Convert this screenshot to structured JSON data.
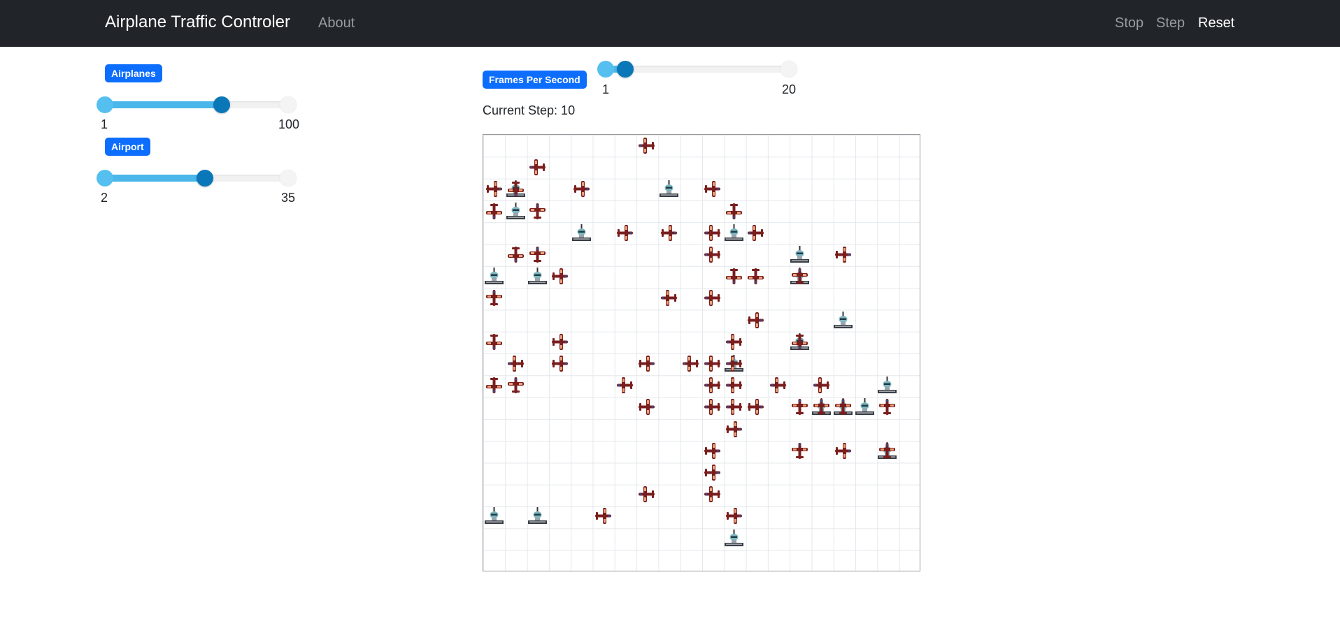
{
  "navbar": {
    "brand": "Airplane Traffic Controler",
    "about": "About",
    "stop": "Stop",
    "step": "Step",
    "reset": "Reset"
  },
  "airplanes_control": {
    "label": "Airplanes",
    "min_label": "1",
    "max_label": "100",
    "min": 1,
    "max": 100,
    "value": 64
  },
  "airport_control": {
    "label": "Airport",
    "min_label": "2",
    "max_label": "35",
    "min": 2,
    "max": 35,
    "value": 20
  },
  "fps_control": {
    "label": "Frames Per Second",
    "min_label": "1",
    "max_label": "20",
    "min": 1,
    "max": 20,
    "value": 3
  },
  "status": {
    "current_step": "Current Step: 10"
  },
  "grid": {
    "rows": 20,
    "cols": 20,
    "airports": [
      [
        2,
        1
      ],
      [
        2,
        8
      ],
      [
        3,
        1
      ],
      [
        4,
        4
      ],
      [
        4,
        11
      ],
      [
        5,
        14
      ],
      [
        6,
        0
      ],
      [
        6,
        2
      ],
      [
        6,
        14
      ],
      [
        8,
        16
      ],
      [
        9,
        14
      ],
      [
        10,
        11
      ],
      [
        11,
        18
      ],
      [
        12,
        15
      ],
      [
        12,
        16
      ],
      [
        12,
        17
      ],
      [
        14,
        18
      ],
      [
        17,
        0
      ],
      [
        17,
        2
      ],
      [
        18,
        11
      ]
    ],
    "planes": [
      [
        0,
        7,
        "left"
      ],
      [
        1,
        2,
        "left"
      ],
      [
        2,
        0,
        "right"
      ],
      [
        2,
        1,
        "down"
      ],
      [
        2,
        4,
        "right"
      ],
      [
        2,
        10,
        "right"
      ],
      [
        3,
        0,
        "down"
      ],
      [
        3,
        2,
        "up"
      ],
      [
        3,
        11,
        "down"
      ],
      [
        4,
        6,
        "right"
      ],
      [
        4,
        8,
        "right"
      ],
      [
        4,
        10,
        "left"
      ],
      [
        4,
        12,
        "left"
      ],
      [
        5,
        1,
        "down"
      ],
      [
        5,
        2,
        "up"
      ],
      [
        5,
        10,
        "left"
      ],
      [
        5,
        16,
        "right"
      ],
      [
        6,
        3,
        "right"
      ],
      [
        6,
        11,
        "down"
      ],
      [
        6,
        12,
        "down"
      ],
      [
        6,
        14,
        "up"
      ],
      [
        7,
        0,
        "up"
      ],
      [
        7,
        8,
        "left"
      ],
      [
        7,
        10,
        "left"
      ],
      [
        8,
        12,
        "right"
      ],
      [
        9,
        0,
        "down"
      ],
      [
        9,
        3,
        "right"
      ],
      [
        9,
        11,
        "left"
      ],
      [
        9,
        14,
        "down"
      ],
      [
        10,
        1,
        "left"
      ],
      [
        10,
        3,
        "right"
      ],
      [
        10,
        7,
        "right"
      ],
      [
        10,
        9,
        "left"
      ],
      [
        10,
        10,
        "left"
      ],
      [
        10,
        11,
        "left"
      ],
      [
        11,
        0,
        "down"
      ],
      [
        11,
        1,
        "up"
      ],
      [
        11,
        6,
        "left"
      ],
      [
        11,
        10,
        "left"
      ],
      [
        11,
        11,
        "left"
      ],
      [
        11,
        13,
        "left"
      ],
      [
        11,
        15,
        "left"
      ],
      [
        12,
        7,
        "right"
      ],
      [
        12,
        10,
        "left"
      ],
      [
        12,
        11,
        "left"
      ],
      [
        12,
        12,
        "right"
      ],
      [
        12,
        14,
        "up"
      ],
      [
        12,
        15,
        "up"
      ],
      [
        12,
        16,
        "up"
      ],
      [
        12,
        18,
        "up"
      ],
      [
        13,
        11,
        "right"
      ],
      [
        14,
        10,
        "right"
      ],
      [
        14,
        14,
        "up"
      ],
      [
        14,
        16,
        "right"
      ],
      [
        14,
        18,
        "up"
      ],
      [
        15,
        10,
        "right"
      ],
      [
        16,
        7,
        "left"
      ],
      [
        16,
        10,
        "left"
      ],
      [
        17,
        5,
        "right"
      ],
      [
        17,
        11,
        "right"
      ]
    ]
  },
  "colors": {
    "navbar": "#212529",
    "badge": "#0d6efd",
    "slider_fill": "#4ab6ea",
    "slider_knob": "#0a77b8",
    "plane_body": "#7a1e1e",
    "plane_wing_light": "#e8a27a",
    "airport_top": "#7fb6c0",
    "airport_base": "#3a3f46"
  }
}
